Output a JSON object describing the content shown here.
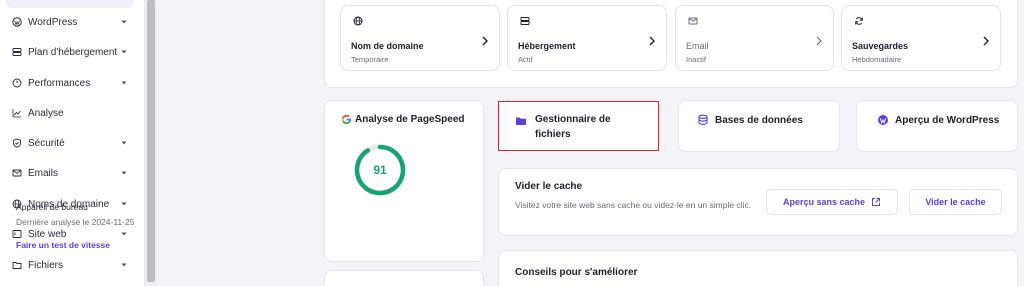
{
  "sidebar": {
    "items": [
      {
        "label": "WordPress",
        "icon": "wordpress-icon",
        "has_chevron": true
      },
      {
        "label": "Plan d'hébergement",
        "icon": "server-icon",
        "has_chevron": true
      },
      {
        "label": "Performances",
        "icon": "gauge-icon",
        "has_chevron": true
      },
      {
        "label": "Analyse",
        "icon": "chart-line-icon",
        "has_chevron": false
      },
      {
        "label": "Sécurité",
        "icon": "shield-icon",
        "has_chevron": true
      },
      {
        "label": "Emails",
        "icon": "mail-icon",
        "has_chevron": true
      },
      {
        "label": "Noms de domaine",
        "icon": "globe-icon",
        "has_chevron": true
      },
      {
        "label": "Site web",
        "icon": "window-icon",
        "has_chevron": true
      },
      {
        "label": "Fichiers",
        "icon": "folder-icon",
        "has_chevron": true
      }
    ]
  },
  "top_cards": [
    {
      "title": "Nom de domaine",
      "subtitle": "Temporaire",
      "icon": "globe-icon"
    },
    {
      "title": "Hébergement",
      "subtitle": "Actif",
      "icon": "server-icon"
    },
    {
      "title": "Email",
      "subtitle": "Inactif",
      "icon": "mail-icon"
    },
    {
      "title": "Sauvegardes",
      "subtitle": "Hebdomadaire",
      "icon": "refresh-icon"
    }
  ],
  "pagespeed": {
    "title": "Analyse de PageSpeed",
    "score": "91",
    "score_fraction": 0.91,
    "device": "Appareil de bureau",
    "last_analysis": "Dernière analyse le 2024-11-25",
    "test_link": "Faire un test de vitesse"
  },
  "shortcuts": {
    "file_manager": "Gestionnaire de fichiers",
    "databases": "Bases de données",
    "wp_overview": "Aperçu de WordPress"
  },
  "cache": {
    "title": "Vider le cache",
    "description": "Visitez votre site web sans cache ou videz-le en un simple clic.",
    "preview_button": "Aperçu sans cache",
    "clear_button": "Vider le cache"
  },
  "tips": {
    "title": "Conseils pour s'améliorer"
  },
  "colors": {
    "accent": "#5b3fd6",
    "gauge": "#18a36f",
    "highlight_border": "#e0242b"
  }
}
